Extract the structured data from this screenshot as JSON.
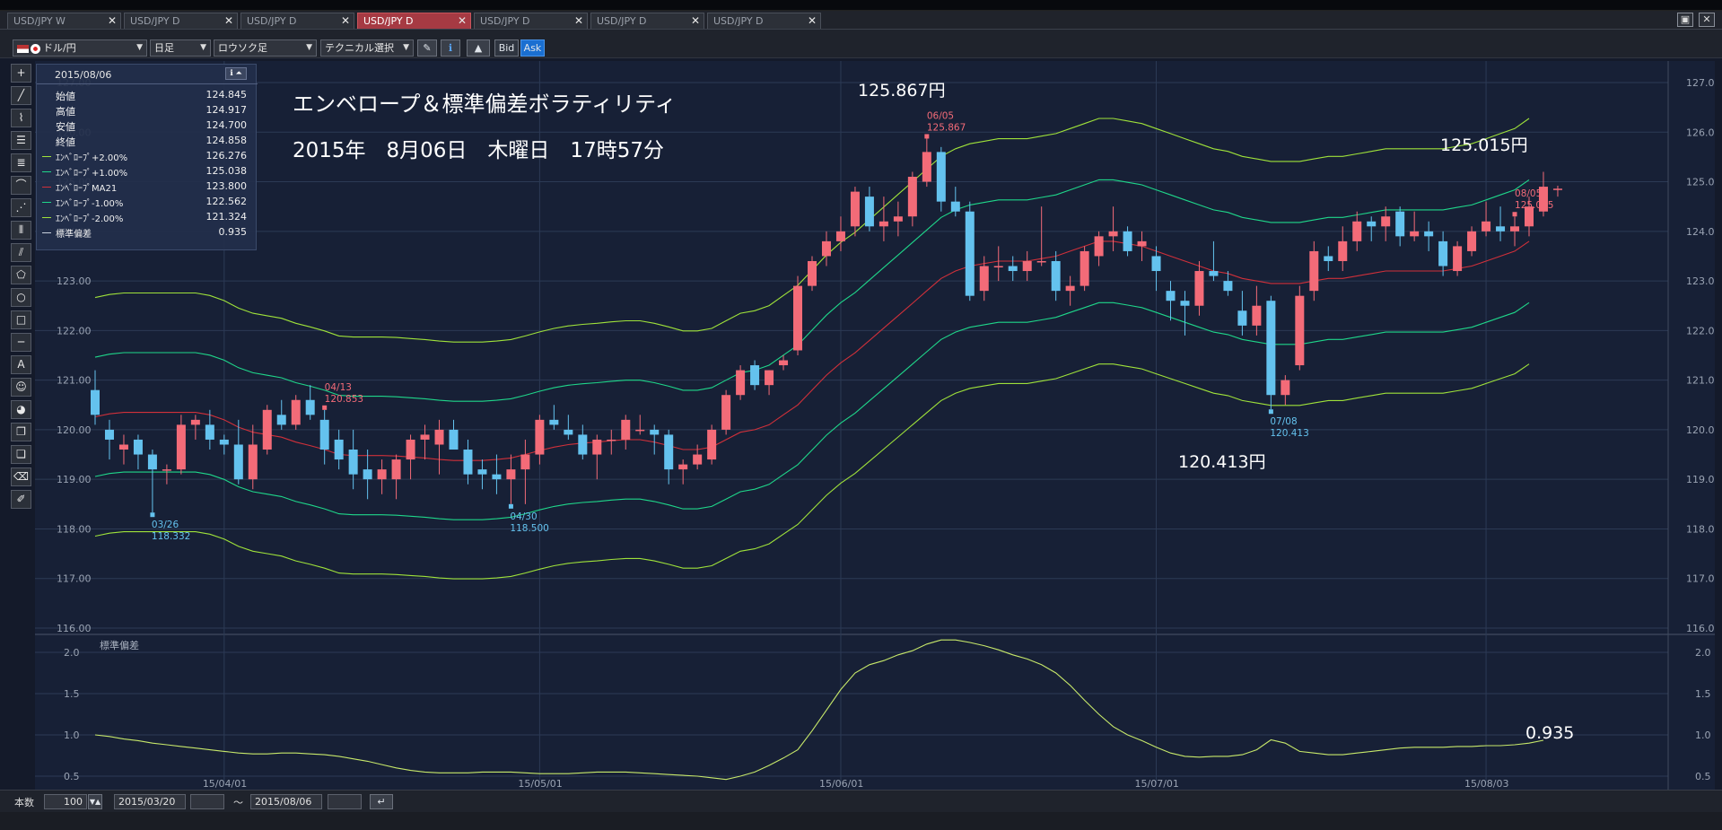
{
  "tabs": [
    {
      "label": "USD/JPY W",
      "active": false
    },
    {
      "label": "USD/JPY D",
      "active": false
    },
    {
      "label": "USD/JPY D",
      "active": false
    },
    {
      "label": "USD/JPY D",
      "active": true
    },
    {
      "label": "USD/JPY D",
      "active": false
    },
    {
      "label": "USD/JPY D",
      "active": false
    },
    {
      "label": "USD/JPY D",
      "active": false
    }
  ],
  "toolbar": {
    "pair": "ドル/円",
    "timeframe": "日足",
    "chart_style": "ロウソク足",
    "technical": "テクニカル選択",
    "bid": "Bid",
    "ask": "Ask"
  },
  "info": {
    "date": "2015/08/06",
    "rows": [
      {
        "label": "始値",
        "value": "124.845",
        "color": ""
      },
      {
        "label": "高値",
        "value": "124.917",
        "color": ""
      },
      {
        "label": "安値",
        "value": "124.700",
        "color": ""
      },
      {
        "label": "終値",
        "value": "124.858",
        "color": ""
      },
      {
        "label": "ｴﾝﾍﾞﾛｰﾌﾟ+2.00%",
        "value": "126.276",
        "color": "#9fe23a"
      },
      {
        "label": "ｴﾝﾍﾞﾛｰﾌﾟ+1.00%",
        "value": "125.038",
        "color": "#1fd68a"
      },
      {
        "label": "ｴﾝﾍﾞﾛｰﾌﾟMA21",
        "value": "123.800",
        "color": "#d0303a"
      },
      {
        "label": "ｴﾝﾍﾞﾛｰﾌﾟ-1.00%",
        "value": "122.562",
        "color": "#1fd68a"
      },
      {
        "label": "ｴﾝﾍﾞﾛｰﾌﾟ-2.00%",
        "value": "121.324",
        "color": "#9fe23a"
      },
      {
        "label": "標準偏差",
        "value": "0.935",
        "color": "#c8d0dc"
      }
    ]
  },
  "annotations": {
    "title": "エンベロープ＆標準偏差ボラティリティ",
    "datetime": "2015年　8月06日　木曜日　17時57分",
    "high_label": "125.867円",
    "last_label": "125.015円",
    "low_label": "120.413円",
    "sd_label": "0.935",
    "sub_title": "標準偏差"
  },
  "bottom": {
    "count_label": "本数",
    "count": "100",
    "from": "2015/03/20",
    "tilde": "〜",
    "to": "2015/08/06"
  },
  "chart_data": {
    "type": "candlestick",
    "series_note": "USD/JPY daily candles with envelope bands",
    "ylim": [
      116,
      127
    ],
    "yticks": [
      "116.00",
      "117.00",
      "118.00",
      "119.00",
      "120.00",
      "121.00",
      "122.00",
      "123.00",
      "124.00",
      "125.00",
      "126.00",
      "127.00"
    ],
    "xticks": [
      {
        "label": "15/04/01",
        "index": 9
      },
      {
        "label": "15/05/01",
        "index": 31
      },
      {
        "label": "15/06/01",
        "index": 52
      },
      {
        "label": "15/07/01",
        "index": 74
      },
      {
        "label": "15/08/03",
        "index": 97
      }
    ],
    "candles": [
      [
        120.8,
        121.2,
        120.1,
        120.3
      ],
      [
        120.0,
        120.2,
        119.4,
        119.8
      ],
      [
        119.6,
        119.9,
        119.3,
        119.7
      ],
      [
        119.8,
        119.9,
        119.2,
        119.5
      ],
      [
        119.5,
        119.6,
        118.33,
        119.2
      ],
      [
        119.2,
        119.3,
        118.9,
        119.2
      ],
      [
        119.2,
        120.3,
        119.1,
        120.1
      ],
      [
        120.1,
        120.3,
        119.8,
        120.2
      ],
      [
        120.1,
        120.4,
        119.6,
        119.8
      ],
      [
        119.8,
        119.9,
        119.5,
        119.7
      ],
      [
        119.7,
        120.2,
        118.9,
        119.0
      ],
      [
        119.0,
        120.1,
        118.8,
        119.7
      ],
      [
        119.6,
        120.5,
        119.5,
        120.4
      ],
      [
        120.3,
        120.6,
        120.0,
        120.1
      ],
      [
        120.1,
        120.7,
        120.0,
        120.6
      ],
      [
        120.6,
        120.9,
        120.2,
        120.3
      ],
      [
        120.2,
        120.4,
        119.3,
        119.6
      ],
      [
        119.8,
        120.0,
        119.2,
        119.4
      ],
      [
        119.6,
        120.0,
        118.8,
        119.1
      ],
      [
        119.2,
        119.6,
        118.6,
        119.0
      ],
      [
        119.0,
        119.4,
        118.7,
        119.2
      ],
      [
        119.0,
        119.5,
        118.6,
        119.4
      ],
      [
        119.4,
        119.9,
        119.0,
        119.8
      ],
      [
        119.8,
        120.1,
        119.4,
        119.9
      ],
      [
        119.7,
        120.2,
        119.1,
        120.0
      ],
      [
        120.0,
        120.2,
        119.6,
        119.6
      ],
      [
        119.6,
        119.8,
        118.9,
        119.1
      ],
      [
        119.2,
        119.4,
        118.8,
        119.1
      ],
      [
        119.1,
        119.5,
        118.7,
        119.0
      ],
      [
        119.0,
        119.5,
        118.5,
        119.2
      ],
      [
        119.2,
        119.8,
        118.5,
        119.5
      ],
      [
        119.5,
        120.3,
        119.3,
        120.2
      ],
      [
        120.2,
        120.5,
        120.0,
        120.1
      ],
      [
        120.0,
        120.3,
        119.8,
        119.9
      ],
      [
        119.9,
        120.1,
        119.4,
        119.5
      ],
      [
        119.5,
        119.9,
        119.0,
        119.8
      ],
      [
        119.8,
        120.0,
        119.5,
        119.8
      ],
      [
        119.8,
        120.3,
        119.6,
        120.2
      ],
      [
        120.0,
        120.3,
        119.9,
        120.0
      ],
      [
        120.0,
        120.1,
        119.5,
        119.9
      ],
      [
        119.9,
        120.0,
        118.9,
        119.2
      ],
      [
        119.2,
        119.4,
        118.9,
        119.3
      ],
      [
        119.3,
        119.7,
        119.2,
        119.5
      ],
      [
        119.4,
        120.1,
        119.3,
        120.0
      ],
      [
        120.0,
        120.8,
        119.9,
        120.7
      ],
      [
        120.7,
        121.3,
        120.6,
        121.2
      ],
      [
        121.3,
        121.4,
        120.8,
        120.9
      ],
      [
        120.9,
        121.2,
        120.7,
        121.2
      ],
      [
        121.3,
        121.5,
        121.2,
        121.4
      ],
      [
        121.6,
        123.1,
        121.5,
        122.9
      ],
      [
        122.9,
        123.5,
        122.8,
        123.4
      ],
      [
        123.5,
        124.0,
        123.3,
        123.8
      ],
      [
        123.8,
        124.3,
        123.6,
        124.0
      ],
      [
        124.1,
        124.9,
        123.9,
        124.8
      ],
      [
        124.7,
        124.9,
        124.0,
        124.1
      ],
      [
        124.1,
        124.7,
        123.8,
        124.2
      ],
      [
        124.2,
        124.6,
        123.9,
        124.3
      ],
      [
        124.3,
        125.2,
        124.1,
        125.1
      ],
      [
        125.0,
        125.87,
        124.9,
        125.6
      ],
      [
        125.6,
        125.7,
        124.4,
        124.6
      ],
      [
        124.6,
        124.9,
        124.3,
        124.4
      ],
      [
        124.4,
        124.6,
        122.6,
        122.7
      ],
      [
        122.8,
        123.5,
        122.6,
        123.3
      ],
      [
        123.3,
        123.7,
        123.0,
        123.3
      ],
      [
        123.3,
        123.5,
        123.0,
        123.2
      ],
      [
        123.2,
        123.6,
        123.0,
        123.4
      ],
      [
        123.4,
        124.5,
        123.3,
        123.4
      ],
      [
        123.4,
        123.6,
        122.6,
        122.8
      ],
      [
        122.8,
        123.1,
        122.5,
        122.9
      ],
      [
        122.9,
        123.7,
        122.8,
        123.6
      ],
      [
        123.5,
        124.0,
        123.3,
        123.9
      ],
      [
        123.9,
        124.5,
        123.6,
        124.0
      ],
      [
        124.0,
        124.1,
        123.5,
        123.6
      ],
      [
        123.7,
        124.0,
        123.4,
        123.8
      ],
      [
        123.5,
        123.7,
        122.8,
        123.2
      ],
      [
        122.8,
        123.0,
        122.2,
        122.6
      ],
      [
        122.6,
        122.8,
        121.9,
        122.5
      ],
      [
        122.5,
        123.4,
        122.3,
        123.2
      ],
      [
        123.2,
        123.8,
        123.0,
        123.1
      ],
      [
        123.0,
        123.2,
        122.7,
        122.8
      ],
      [
        122.4,
        122.8,
        121.9,
        122.1
      ],
      [
        122.1,
        122.9,
        121.9,
        122.5
      ],
      [
        122.6,
        122.7,
        120.41,
        120.7
      ],
      [
        120.7,
        121.1,
        120.5,
        121.0
      ],
      [
        121.3,
        122.9,
        121.2,
        122.7
      ],
      [
        122.8,
        123.8,
        122.6,
        123.6
      ],
      [
        123.5,
        123.7,
        123.2,
        123.4
      ],
      [
        123.4,
        124.1,
        123.2,
        123.8
      ],
      [
        123.8,
        124.4,
        123.6,
        124.2
      ],
      [
        124.2,
        124.3,
        123.8,
        124.1
      ],
      [
        124.1,
        124.5,
        123.8,
        124.3
      ],
      [
        124.4,
        124.5,
        123.7,
        123.9
      ],
      [
        123.9,
        124.4,
        123.8,
        124.0
      ],
      [
        124.0,
        124.2,
        123.6,
        123.9
      ],
      [
        123.8,
        124.0,
        123.1,
        123.3
      ],
      [
        123.2,
        123.8,
        123.1,
        123.7
      ],
      [
        123.6,
        124.1,
        123.5,
        124.0
      ],
      [
        124.0,
        124.6,
        123.9,
        124.2
      ],
      [
        124.1,
        124.5,
        123.8,
        124.0
      ],
      [
        124.0,
        124.3,
        123.7,
        124.1
      ],
      [
        124.1,
        124.7,
        123.9,
        124.5
      ],
      [
        124.4,
        125.2,
        124.3,
        124.9
      ],
      [
        124.85,
        124.92,
        124.7,
        124.86
      ]
    ],
    "ma21": [
      120.26,
      120.32,
      120.35,
      120.35,
      120.35,
      120.35,
      120.35,
      120.35,
      120.3,
      120.2,
      120.05,
      119.95,
      119.9,
      119.85,
      119.75,
      119.68,
      119.6,
      119.5,
      119.48,
      119.48,
      119.48,
      119.47,
      119.45,
      119.43,
      119.4,
      119.38,
      119.38,
      119.38,
      119.4,
      119.43,
      119.5,
      119.58,
      119.65,
      119.7,
      119.73,
      119.75,
      119.78,
      119.8,
      119.8,
      119.75,
      119.68,
      119.6,
      119.6,
      119.65,
      119.8,
      119.95,
      120.0,
      120.1,
      120.3,
      120.5,
      120.8,
      121.1,
      121.35,
      121.55,
      121.8,
      122.05,
      122.3,
      122.55,
      122.8,
      123.05,
      123.2,
      123.3,
      123.35,
      123.4,
      123.4,
      123.4,
      123.45,
      123.5,
      123.6,
      123.7,
      123.8,
      123.8,
      123.75,
      123.7,
      123.6,
      123.5,
      123.4,
      123.3,
      123.2,
      123.15,
      123.05,
      123.0,
      122.95,
      122.95,
      122.95,
      123.0,
      123.05,
      123.05,
      123.1,
      123.15,
      123.2,
      123.2,
      123.2,
      123.2,
      123.2,
      123.25,
      123.3,
      123.4,
      123.5,
      123.6,
      123.8
    ],
    "env_pct": [
      2,
      1,
      -1,
      -2
    ],
    "std_dev": {
      "ylim": [
        0.3,
        2.2
      ],
      "yticks": [
        "2.0",
        "1.5",
        "1.0",
        "0.5"
      ],
      "values": [
        1.0,
        0.98,
        0.95,
        0.93,
        0.9,
        0.88,
        0.86,
        0.84,
        0.82,
        0.8,
        0.78,
        0.77,
        0.77,
        0.78,
        0.78,
        0.77,
        0.76,
        0.74,
        0.71,
        0.68,
        0.64,
        0.6,
        0.57,
        0.55,
        0.54,
        0.54,
        0.54,
        0.55,
        0.55,
        0.55,
        0.54,
        0.53,
        0.53,
        0.53,
        0.54,
        0.55,
        0.55,
        0.55,
        0.54,
        0.53,
        0.52,
        0.51,
        0.5,
        0.48,
        0.46,
        0.5,
        0.55,
        0.63,
        0.72,
        0.82,
        1.05,
        1.3,
        1.55,
        1.75,
        1.85,
        1.9,
        1.97,
        2.02,
        2.1,
        2.15,
        2.15,
        2.12,
        2.08,
        2.03,
        1.97,
        1.92,
        1.85,
        1.75,
        1.6,
        1.42,
        1.25,
        1.1,
        1.0,
        0.93,
        0.85,
        0.78,
        0.74,
        0.73,
        0.74,
        0.74,
        0.76,
        0.82,
        0.94,
        0.9,
        0.8,
        0.78,
        0.76,
        0.76,
        0.78,
        0.8,
        0.82,
        0.84,
        0.85,
        0.85,
        0.85,
        0.86,
        0.86,
        0.87,
        0.87,
        0.88,
        0.9,
        0.935
      ]
    },
    "annotations": [
      {
        "date": "03/26",
        "price": "118.332",
        "index": 4
      },
      {
        "date": "04/13",
        "price": "120.853",
        "index": 16
      },
      {
        "date": "04/30",
        "price": "118.500",
        "index": 29
      },
      {
        "date": "06/05",
        "price": "125.867",
        "index": 58
      },
      {
        "date": "07/08",
        "price": "120.413",
        "index": 82
      },
      {
        "date": "08/05",
        "price": "125.015",
        "index": 99
      }
    ]
  }
}
